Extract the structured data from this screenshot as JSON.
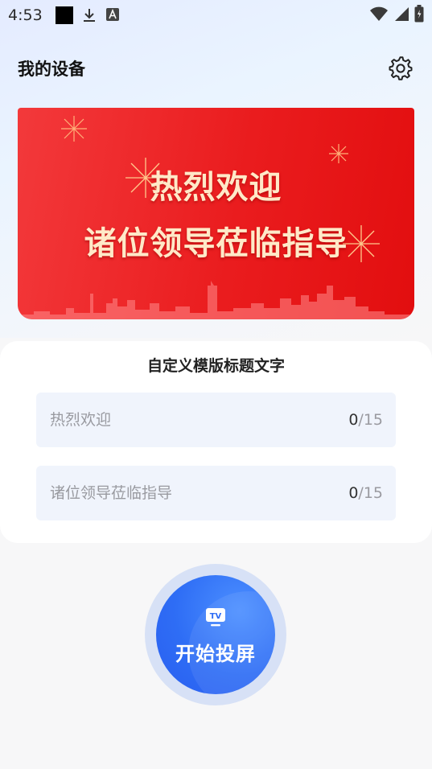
{
  "status_bar": {
    "time": "4:53"
  },
  "header": {
    "title": "我的设备"
  },
  "banner": {
    "line1": "热烈欢迎",
    "line2": "诸位领导莅临指导"
  },
  "template_form": {
    "title": "自定义模版标题文字",
    "fields": [
      {
        "placeholder": "热烈欢迎",
        "value": "",
        "count": "0",
        "max": "/15"
      },
      {
        "placeholder": "诸位领导莅临指导",
        "value": "",
        "count": "0",
        "max": "/15"
      }
    ]
  },
  "cast_button": {
    "label": "开始投屏",
    "icon_text": "TV"
  },
  "colors": {
    "banner_red": "#e8191b",
    "banner_text": "#ffe9c8",
    "accent_blue": "#2e6df5",
    "field_bg": "#f0f4fc"
  },
  "icons": [
    "download-icon",
    "a-icon",
    "wifi-icon",
    "signal-icon",
    "battery-icon",
    "gear-icon",
    "tv-icon"
  ]
}
